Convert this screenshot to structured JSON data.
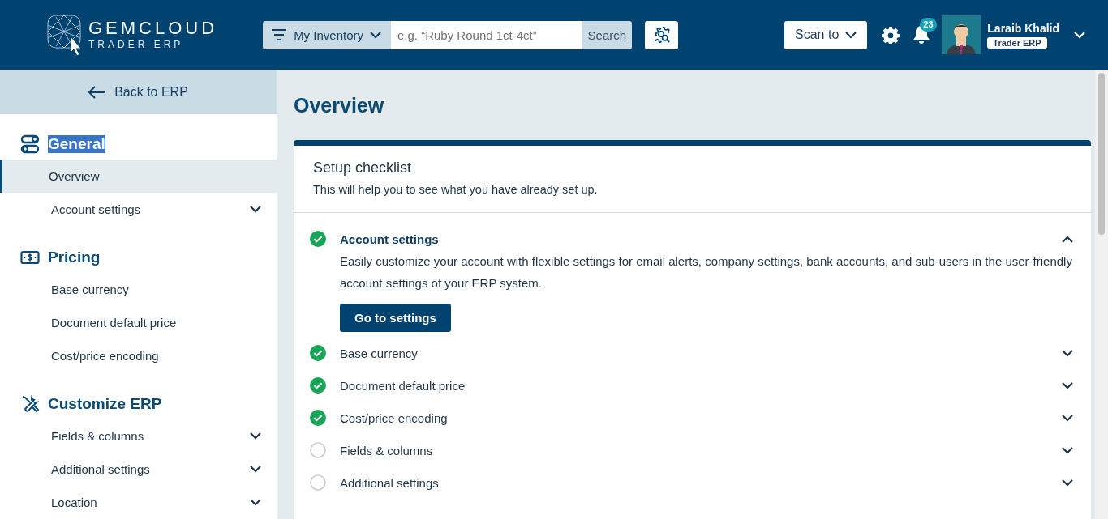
{
  "header": {
    "logo": {
      "name": "GEMCLOUD",
      "tagline": "TRADER ERP"
    },
    "search": {
      "scope": "My Inventory",
      "placeholder": "e.g. “Ruby Round 1ct-4ct”",
      "button": "Search"
    },
    "scan_button": "Scan to",
    "notifications": {
      "count": "23"
    },
    "user": {
      "name": "Laraib Khalid",
      "role": "Trader ERP"
    }
  },
  "sidebar": {
    "back_link": "Back to ERP",
    "sections": [
      {
        "kind": "toggles",
        "title": "General",
        "highlighted": true,
        "items": [
          {
            "label": "Overview",
            "selected": true,
            "expandable": false
          },
          {
            "label": "Account settings",
            "selected": false,
            "expandable": true
          }
        ]
      },
      {
        "kind": "money",
        "title": "Pricing",
        "highlighted": false,
        "items": [
          {
            "label": "Base currency",
            "selected": false,
            "expandable": false
          },
          {
            "label": "Document default price",
            "selected": false,
            "expandable": false
          },
          {
            "label": "Cost/price encoding",
            "selected": false,
            "expandable": false
          }
        ]
      },
      {
        "kind": "tools",
        "title": "Customize ERP",
        "highlighted": false,
        "items": [
          {
            "label": "Fields & columns",
            "selected": false,
            "expandable": true
          },
          {
            "label": "Additional settings",
            "selected": false,
            "expandable": true
          },
          {
            "label": "Location",
            "selected": false,
            "expandable": true
          }
        ]
      }
    ]
  },
  "page_title": "Overview",
  "checklist": {
    "title": "Setup checklist",
    "subtitle": "This will help you to see what you have already set up.",
    "items": [
      {
        "label": "Account settings",
        "done": true,
        "expanded": true,
        "description": "Easily customize your account with flexible settings for email alerts, company settings, bank accounts, and sub-users in the user-friendly account settings of your ERP system.",
        "button": "Go to settings"
      },
      {
        "label": "Base currency",
        "done": true,
        "expanded": false
      },
      {
        "label": "Document default price",
        "done": true,
        "expanded": false
      },
      {
        "label": "Cost/price encoding",
        "done": true,
        "expanded": false
      },
      {
        "label": "Fields & columns",
        "done": false,
        "expanded": false
      },
      {
        "label": "Additional settings",
        "done": false,
        "expanded": false
      }
    ]
  }
}
